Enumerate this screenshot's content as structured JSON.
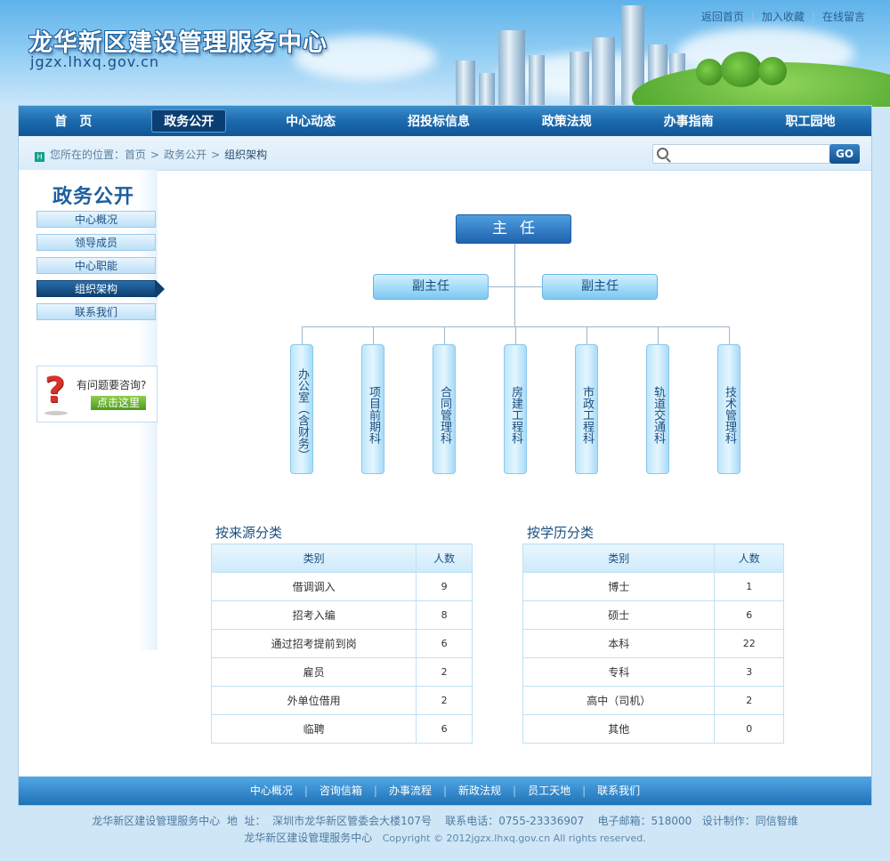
{
  "header": {
    "site_title": "龙华新区建设管理服务中心",
    "site_url": "jgzx.lhxq.gov.cn",
    "top_links": [
      "返回首页",
      "加入收藏",
      "在线留言"
    ]
  },
  "nav": {
    "items": [
      "首　页",
      "政务公开",
      "中心动态",
      "招投标信息",
      "政策法规",
      "办事指南",
      "职工园地"
    ],
    "active_index": 1
  },
  "breadcrumb": {
    "prefix": "您所在的位置：",
    "items": [
      "首页",
      "政务公开",
      "组织架构"
    ]
  },
  "search": {
    "placeholder": "",
    "button_label": "GO"
  },
  "sidebar": {
    "title": "政务公开",
    "items": [
      "中心概况",
      "领导成员",
      "中心职能",
      "组织架构",
      "联系我们"
    ],
    "active_index": 3,
    "help_text": "有问题要咨询?",
    "help_button": "点击这里"
  },
  "org_chart": {
    "director": "主任",
    "deputies": [
      "副主任",
      "副主任"
    ],
    "departments": [
      "办公室（含财务）",
      "项目前期科",
      "合同管理科",
      "房建工程科",
      "市政工程科",
      "轨道交通科",
      "技术管理科"
    ]
  },
  "tables": [
    {
      "title": "按来源分类",
      "headers": [
        "类别",
        "人数"
      ],
      "rows": [
        [
          "借调调入",
          "9"
        ],
        [
          "招考入编",
          "8"
        ],
        [
          "通过招考提前到岗",
          "6"
        ],
        [
          "雇员",
          "2"
        ],
        [
          "外单位借用",
          "2"
        ],
        [
          "临聘",
          "6"
        ]
      ]
    },
    {
      "title": "按学历分类",
      "headers": [
        "类别",
        "人数"
      ],
      "rows": [
        [
          "博士",
          "1"
        ],
        [
          "硕士",
          "6"
        ],
        [
          "本科",
          "22"
        ],
        [
          "专科",
          "3"
        ],
        [
          "高中（司机）",
          "2"
        ],
        [
          "其他",
          "0"
        ]
      ]
    }
  ],
  "footer": {
    "nav": [
      "中心概况",
      "咨询信箱",
      "办事流程",
      "新政法规",
      "员工天地",
      "联系我们"
    ],
    "info_line": "龙华新区建设管理服务中心  地  址：  深圳市龙华新区管委会大楼107号    联系电话：0755-23336907    电子邮箱：518000   设计制作：同信智维",
    "copyright_name": "龙华新区建设管理服务中心",
    "copyright": "Copyright © 2012jgzx.lhxq.gov.cn All rights reserved."
  }
}
